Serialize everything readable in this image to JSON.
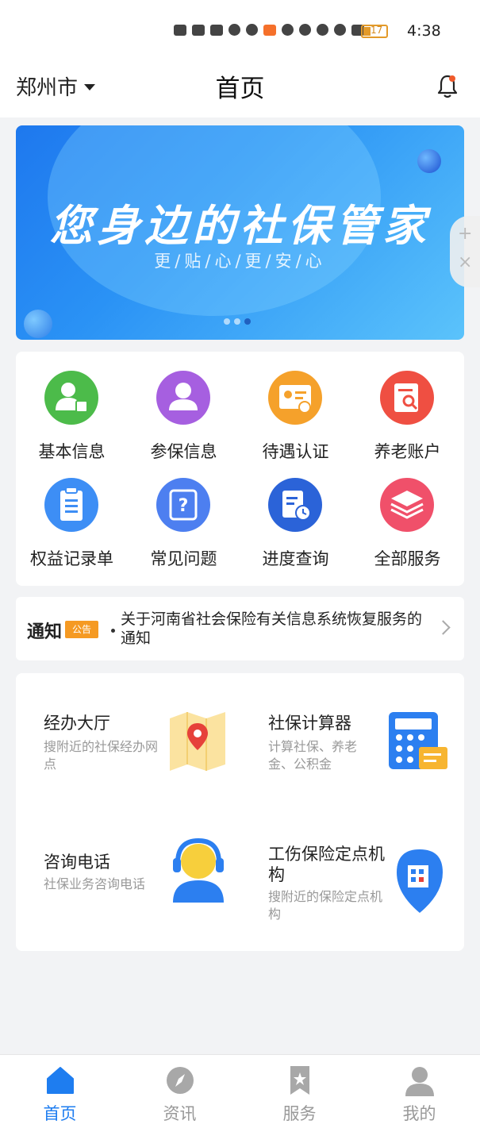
{
  "status_bar": {
    "time": "4:38",
    "battery": "17"
  },
  "header": {
    "city": "郑州市",
    "title": "首页"
  },
  "banner": {
    "title": "您身边的社保管家",
    "subtitle": "更/贴/心/更/安/心",
    "slide_count": 3,
    "active_slide": 3
  },
  "services_grid": [
    {
      "label": "基本信息",
      "icon": "person-id-icon",
      "color": "#4cbb4a"
    },
    {
      "label": "参保信息",
      "icon": "person-icon",
      "color": "#a65fe0"
    },
    {
      "label": "待遇认证",
      "icon": "id-card-check-icon",
      "color": "#f5a12b"
    },
    {
      "label": "养老账户",
      "icon": "ledger-search-icon",
      "color": "#ef4f42"
    },
    {
      "label": "权益记录单",
      "icon": "clipboard-icon",
      "color": "#3d8ef5"
    },
    {
      "label": "常见问题",
      "icon": "question-doc-icon",
      "color": "#4d7ff0"
    },
    {
      "label": "进度查询",
      "icon": "document-clock-icon",
      "color": "#2b63d8"
    },
    {
      "label": "全部服务",
      "icon": "layers-icon",
      "color": "#f0506a"
    }
  ],
  "notice": {
    "title": "通知",
    "tag": "公告",
    "text": "关于河南省社会保险有关信息系统恢复服务的通知"
  },
  "service_cards": [
    {
      "title": "经办大厅",
      "desc": "搜附近的社保经办网点",
      "icon": "map-pin-icon"
    },
    {
      "title": "社保计算器",
      "desc": "计算社保、养老金、公积金",
      "icon": "calculator-icon"
    },
    {
      "title": "咨询电话",
      "desc": "社保业务咨询电话",
      "icon": "headset-agent-icon"
    },
    {
      "title": "工伤保险定点机构",
      "desc": "搜附近的保险定点机构",
      "icon": "building-pin-icon"
    }
  ],
  "tabbar": [
    {
      "label": "首页",
      "icon": "home-icon",
      "active": true
    },
    {
      "label": "资讯",
      "icon": "compass-icon",
      "active": false
    },
    {
      "label": "服务",
      "icon": "bookmark-star-icon",
      "active": false
    },
    {
      "label": "我的",
      "icon": "user-icon",
      "active": false
    }
  ]
}
